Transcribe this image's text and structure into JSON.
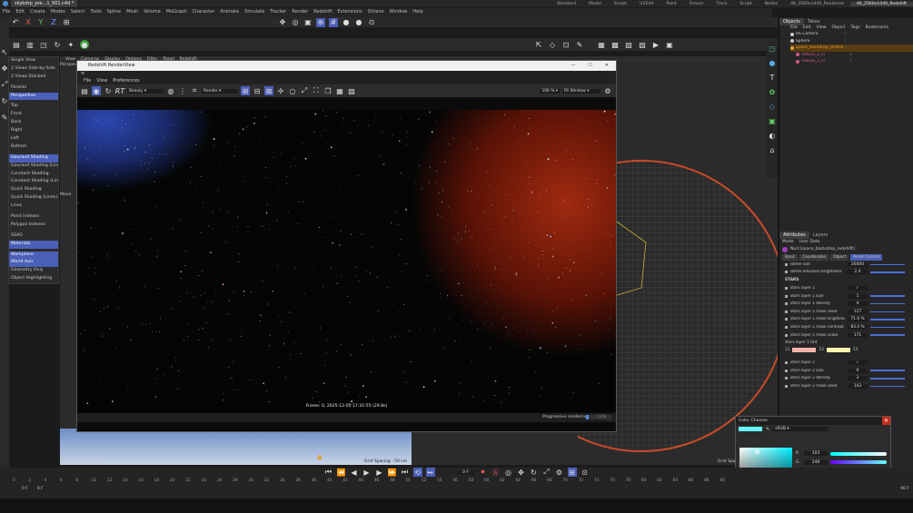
{
  "app": {
    "title": "skybdrp_pre...1_001.c4d *",
    "tabs_right": [
      "Standard",
      "Model",
      "Sculpt",
      "UVEdit",
      "Paint",
      "Groom",
      "Track",
      "Script",
      "Nodes",
      "4K_2560x1440_Rendered",
      "4K_2560x1440_Redshift"
    ]
  },
  "menubar": [
    "File",
    "Edit",
    "Create",
    "Modes",
    "Select",
    "Tools",
    "Spline",
    "Mesh",
    "Volume",
    "MoGraph",
    "Character",
    "Animate",
    "Simulate",
    "Tracker",
    "Render",
    "Redshift",
    "Extensions",
    "Octane",
    "Window",
    "Help"
  ],
  "workspace_tabs": [
    "main",
    "octane",
    "rs"
  ],
  "viewport": {
    "menu": [
      "View",
      "Cameras",
      "Display",
      "Options",
      "Filter",
      "Panel",
      "Redshift"
    ],
    "label": "Perspect",
    "move_label": "Move",
    "status_left": "View Transform: Scene",
    "status_right": "Grid Spacing : 50 cm",
    "grid_spacing_right": "Grid Spa"
  },
  "view_menu": [
    {
      "label": "Single View",
      "hl": false
    },
    {
      "label": "2 Views Side-by-Side",
      "hl": false
    },
    {
      "label": "2 Views Stacked",
      "hl": false
    },
    {
      "sep": true
    },
    {
      "label": "Parallel",
      "hl": false
    },
    {
      "label": "Perspective",
      "hl": true
    },
    {
      "sep": true
    },
    {
      "label": "Top",
      "hl": false
    },
    {
      "label": "Front",
      "hl": false
    },
    {
      "label": "Back",
      "hl": false
    },
    {
      "label": "Right",
      "hl": false
    },
    {
      "label": "Left",
      "hl": false
    },
    {
      "label": "Bottom",
      "hl": false
    },
    {
      "sep": true
    },
    {
      "label": "Gouraud Shading",
      "hl": true
    },
    {
      "label": "Gouraud Shading (Lines)",
      "hl": false
    },
    {
      "label": "Constant Shading",
      "hl": false
    },
    {
      "label": "Constant Shading (Lines)",
      "hl": false
    },
    {
      "label": "Quick Shading",
      "hl": false
    },
    {
      "label": "Quick Shading (Lines)",
      "hl": false
    },
    {
      "label": "Lines",
      "hl": false
    },
    {
      "sep": true
    },
    {
      "label": "Point Indexes",
      "hl": false
    },
    {
      "label": "Polygon Indexes",
      "hl": false
    },
    {
      "sep": true
    },
    {
      "label": "SSAO",
      "hl": false
    },
    {
      "label": "Materials",
      "hl": true
    },
    {
      "sep": true
    },
    {
      "label": "Workplane",
      "hl": true
    },
    {
      "label": "World Axis",
      "hl": true
    },
    {
      "label": "Geometry Only",
      "hl": false
    },
    {
      "label": "Object Highlighting",
      "hl": false
    }
  ],
  "renderview": {
    "title": "Redshift RenderView",
    "menu": [
      "File",
      "View",
      "Preferences"
    ],
    "aov": "Beauty",
    "render_mode": "Render",
    "zoom": "100 %",
    "fit": "Fit Window",
    "frame_info": "Frame: 0,  2025-12-05  17:31:55  (29.8s)",
    "progressive_label": "Progressive rendering",
    "progress_pct": "12%",
    "progress": 0.12
  },
  "objects_panel": {
    "tabs": [
      "Objects",
      "Takes"
    ],
    "menu": [
      "File",
      "Edit",
      "View",
      "Object",
      "Tags",
      "Bookmarks"
    ],
    "items": [
      {
        "name": "RS Camera",
        "indent": 0,
        "color": "#cccccc"
      },
      {
        "name": "Sphere",
        "indent": 0,
        "color": "#cccccc"
      },
      {
        "name": "space_backdrop_redshift",
        "indent": 0,
        "color": "#e0a03a"
      },
      {
        "name": "nebula_1_rs",
        "indent": 1,
        "color": "#d05a8a"
      },
      {
        "name": "nebula_2_rs",
        "indent": 1,
        "color": "#d05a8a"
      }
    ]
  },
  "attributes": {
    "tabs": [
      "Attributes",
      "Layers"
    ],
    "menu": [
      "Mode",
      "User Data"
    ],
    "object": "Null [space_backdrop_redshift]",
    "subtabs": [
      "Basic",
      "Coordinates",
      "Object",
      "Asset Control"
    ],
    "rows_top": [
      {
        "label": "dome size",
        "value": "20000"
      },
      {
        "label": "dome emission brightness",
        "value": "2.4"
      }
    ],
    "section": "STARS",
    "rows": [
      {
        "label": "stars layer 1",
        "value": "✓"
      },
      {
        "label": "stars layer 1 size",
        "value": "1"
      },
      {
        "label": "stars layer 1 density",
        "value": "4"
      },
      {
        "label": "stars layer 1 mask seed",
        "value": "127"
      },
      {
        "label": "stars layer 1 mask brightness",
        "value": "71.4 %"
      },
      {
        "label": "stars layer 1 mask contrast",
        "value": "83.4 %"
      },
      {
        "label": "stars layer 1 mask scale",
        "value": "171"
      }
    ],
    "tint_label": "stars layer 1 tint",
    "tint_a": "11",
    "tint_b": "12",
    "tint_c": "13",
    "rows2": [
      {
        "label": "stars layer 2",
        "value": "✓"
      },
      {
        "label": "stars layer 2 size",
        "value": "6"
      },
      {
        "label": "stars layer 2 density",
        "value": "3"
      },
      {
        "label": "stars layer 2 mask seed",
        "value": "143"
      }
    ]
  },
  "color_chooser": {
    "title": "Color Chooser",
    "space": "sRGB",
    "channels": [
      {
        "k": "R",
        "v": "103"
      },
      {
        "k": "G",
        "v": "248"
      },
      {
        "k": "B",
        "v": "255"
      },
      {
        "k": "H",
        "v": "184.9999"
      },
      {
        "k": "S",
        "v": "34 %"
      },
      {
        "k": "V",
        "v": "100 %"
      }
    ],
    "swatch": "#67f8ff"
  },
  "timeline": {
    "frames": [
      "0",
      "2",
      "4",
      "6",
      "8",
      "10",
      "12",
      "14",
      "16",
      "18",
      "20",
      "22",
      "24",
      "26",
      "28",
      "30",
      "32",
      "34",
      "36",
      "38",
      "40",
      "42",
      "44",
      "46",
      "48",
      "50",
      "52",
      "54",
      "56",
      "58",
      "60",
      "62",
      "64",
      "66",
      "68",
      "70",
      "72",
      "74",
      "76",
      "78",
      "80",
      "82",
      "84",
      "86",
      "88",
      "90"
    ],
    "start": "0 F",
    "end": "0 F",
    "current": "0 F",
    "end_frame": "90 F",
    "end_frame2": "90 F"
  }
}
